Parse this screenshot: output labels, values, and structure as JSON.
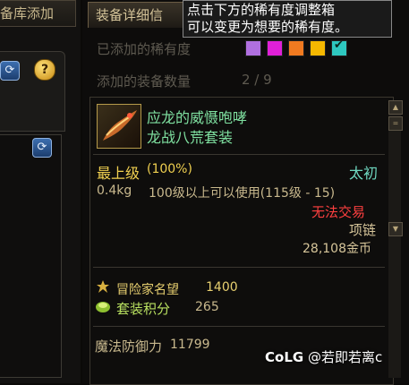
{
  "left": {
    "tab_label": "备库添加"
  },
  "header": {
    "tab_label": "装备详细信",
    "tooltip_line1": "点击下方的稀有度调整箱",
    "tooltip_line2": "可以变更为想要的稀有度。"
  },
  "rarity": {
    "label": "已添加的稀有度",
    "colors": [
      "#b070e0",
      "#e020d8",
      "#f07a20",
      "#f5b800",
      "#2ec8c0"
    ]
  },
  "count": {
    "label": "添加的装备数量",
    "value": "2 / 9"
  },
  "item": {
    "name": "应龙的威慑咆哮",
    "set_name": "龙战八荒套装",
    "grade": "最上级",
    "grade_percent": "(100%)",
    "rarity_name": "太初",
    "weight": "0.4kg",
    "level_req": "100级以上可以使用(115级 - 15)",
    "trade": "无法交易",
    "type": "项链",
    "price": "28,108金币",
    "adventurer_fame_label": "冒险家名望",
    "adventurer_fame_value": "1400",
    "set_points_label": "套装积分",
    "set_points_value": "265",
    "magic_def_label": "魔法防御力",
    "magic_def_value": "11799"
  },
  "watermark": {
    "logo": "CoLG",
    "text": "@若即若离c"
  },
  "colors": {
    "item_name": "#7fe0a0",
    "grade": "#f0d050",
    "rarity_name": "#6fd8c0",
    "trade": "#ff4040",
    "fame": "#e8d070",
    "points": "#b8e060"
  }
}
